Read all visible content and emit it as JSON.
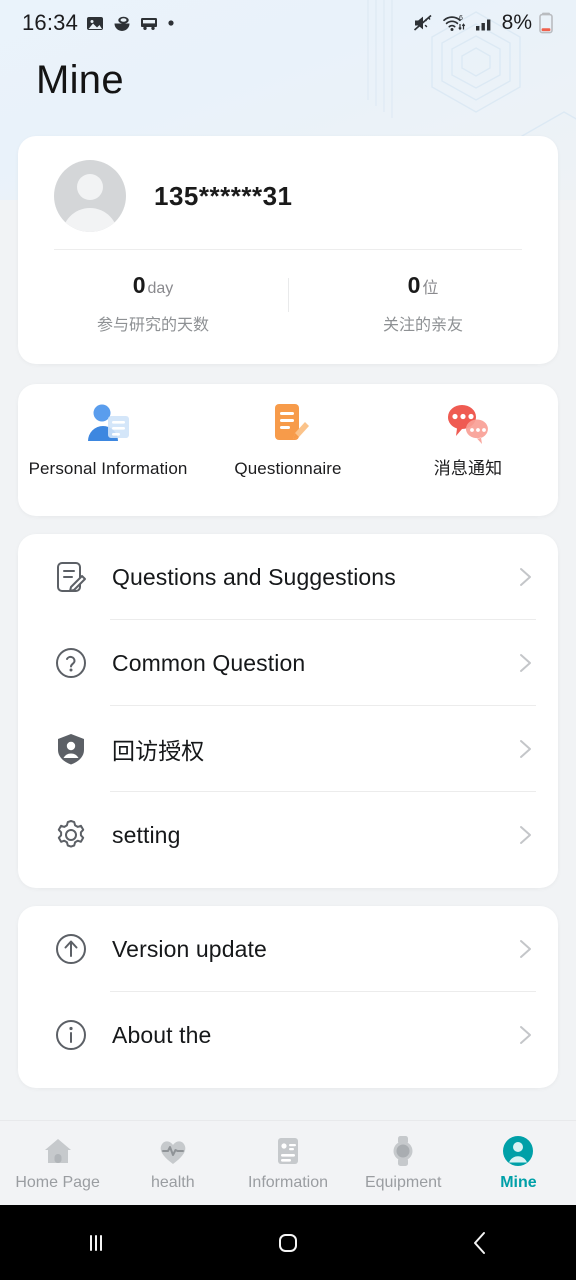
{
  "status_bar": {
    "time": "16:34",
    "battery_percent": "8%",
    "left_icons": [
      "photo-icon",
      "food-bowl-icon",
      "truck-icon",
      "dot-icon"
    ],
    "right_icons": [
      "mute-icon",
      "wifi-6-icon",
      "signal-bars-icon",
      "battery-low-icon"
    ]
  },
  "header": {
    "title": "Mine"
  },
  "profile": {
    "avatar": "default-user-avatar",
    "phone_masked": "135******31",
    "stats": [
      {
        "value": "0",
        "unit": "day",
        "label": "参与研究的天数"
      },
      {
        "value": "0",
        "unit": "位",
        "label": "关注的亲友"
      }
    ]
  },
  "quick_actions": [
    {
      "icon": "personal-information-icon",
      "label": "Personal Information",
      "color": "#4a90e2"
    },
    {
      "icon": "questionnaire-icon",
      "label": "Questionnaire",
      "color": "#f59542"
    },
    {
      "icon": "message-notification-icon",
      "label": "消息通知",
      "color": "#ef5b5b"
    }
  ],
  "menu_groups": [
    {
      "items": [
        {
          "icon": "feedback-form-icon",
          "label": "Questions and Suggestions"
        },
        {
          "icon": "question-circle-icon",
          "label": "Common Question"
        },
        {
          "icon": "shield-person-icon",
          "label": "回访授权"
        },
        {
          "icon": "gear-icon",
          "label": "setting"
        }
      ]
    },
    {
      "items": [
        {
          "icon": "arrow-up-circle-icon",
          "label": "Version update"
        },
        {
          "icon": "info-circle-icon",
          "label": "About the"
        }
      ]
    }
  ],
  "tabs": [
    {
      "icon": "home-icon",
      "label": "Home Page",
      "active": false
    },
    {
      "icon": "heart-pulse-icon",
      "label": "health",
      "active": false
    },
    {
      "icon": "id-card-icon",
      "label": "Information",
      "active": false
    },
    {
      "icon": "watch-icon",
      "label": "Equipment",
      "active": false
    },
    {
      "icon": "user-circle-icon",
      "label": "Mine",
      "active": true
    }
  ],
  "android_nav": {
    "recents": "recents-icon",
    "home": "home-square-icon",
    "back": "back-chevron-icon"
  },
  "colors": {
    "accent": "#00a0a8",
    "page_bg": "#f1f3f5",
    "card_bg": "#ffffff",
    "text_primary": "#16181a",
    "text_secondary": "#8e9194"
  }
}
